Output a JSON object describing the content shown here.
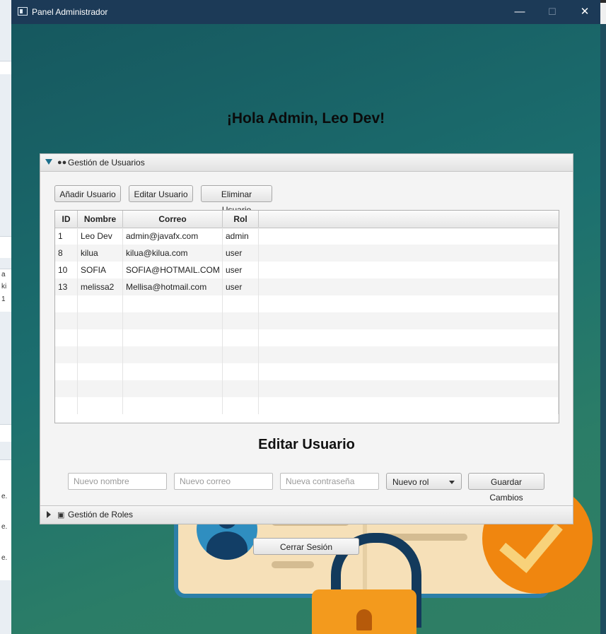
{
  "window": {
    "title": "Panel Administrador",
    "minimize_glyph": "—",
    "maximize_glyph": "☐",
    "close_glyph": "✕"
  },
  "greeting": "¡Hola Admin, Leo Dev!",
  "users_section": {
    "header": "Gestión de Usuarios",
    "icon": "users-icon",
    "buttons": {
      "add": "Añadir Usuario",
      "edit": "Editar Usuario",
      "delete": "Eliminar Usuario"
    },
    "table": {
      "columns": [
        "ID",
        "Nombre",
        "Correo",
        "Rol"
      ],
      "rows": [
        [
          "1",
          "Leo Dev",
          "admin@javafx.com",
          "admin"
        ],
        [
          "8",
          "kilua",
          "kilua@kilua.com",
          "user"
        ],
        [
          "10",
          "SOFIA",
          "SOFIA@HOTMAIL.COM",
          "user"
        ],
        [
          "13",
          "melissa2",
          "Mellisa@hotmail.com",
          "user"
        ]
      ]
    },
    "edit_title": "Editar Usuario",
    "form": {
      "name_placeholder": "Nuevo nombre",
      "email_placeholder": "Nuevo correo",
      "password_placeholder": "Nueva contraseña",
      "role_select": "Nuevo rol",
      "save": "Guardar Cambios"
    }
  },
  "roles_section": {
    "header": "Gestión de Roles",
    "icon": "briefcase-icon"
  },
  "logout": "Cerrar Sesión",
  "background_ide": {
    "glyphs": [
      "a",
      "ki",
      "1",
      "e.",
      "e.",
      "e."
    ]
  },
  "colors": {
    "titlebar": "#1c3a57",
    "accent_arrow": "#1b6f8c",
    "background_teal": "#1a6670"
  }
}
